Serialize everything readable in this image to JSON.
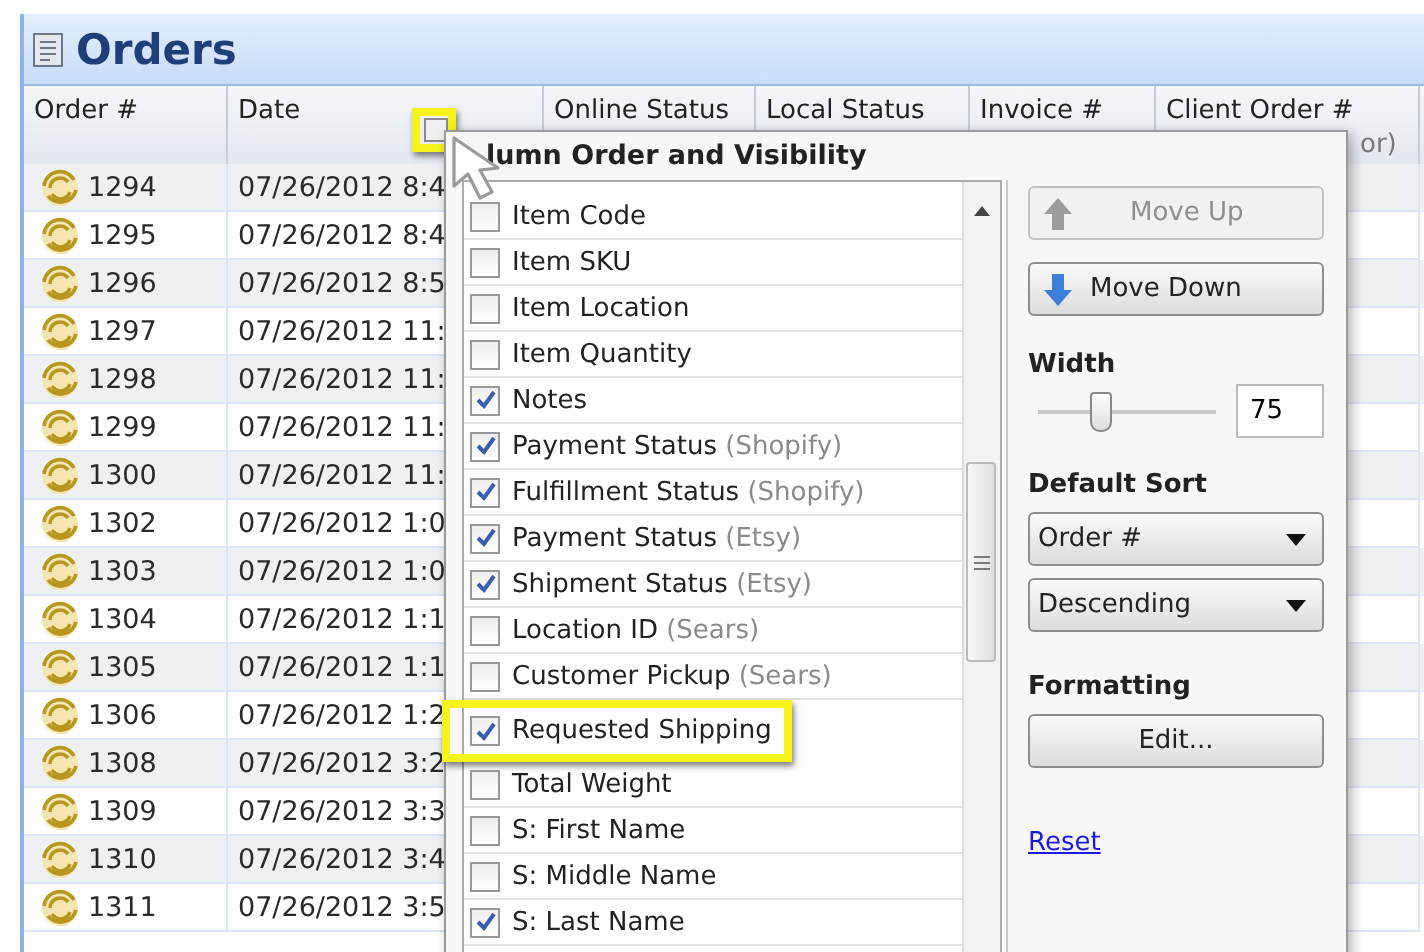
{
  "title": "Orders",
  "columns": [
    {
      "label": "Order #"
    },
    {
      "label": "Date"
    },
    {
      "label": "Online Status"
    },
    {
      "label": "Local Status"
    },
    {
      "label": "Invoice #"
    },
    {
      "label": "Client Order #",
      "label_line_2": "or)"
    }
  ],
  "column_chooser": {
    "highlighted": true
  },
  "rows": [
    {
      "order": "1294",
      "date": "07/26/2012 8:4"
    },
    {
      "order": "1295",
      "date": "07/26/2012 8:4"
    },
    {
      "order": "1296",
      "date": "07/26/2012 8:5"
    },
    {
      "order": "1297",
      "date": "07/26/2012 11:"
    },
    {
      "order": "1298",
      "date": "07/26/2012 11:"
    },
    {
      "order": "1299",
      "date": "07/26/2012 11:"
    },
    {
      "order": "1300",
      "date": "07/26/2012 11:"
    },
    {
      "order": "1302",
      "date": "07/26/2012 1:0"
    },
    {
      "order": "1303",
      "date": "07/26/2012 1:0"
    },
    {
      "order": "1304",
      "date": "07/26/2012 1:1"
    },
    {
      "order": "1305",
      "date": "07/26/2012 1:1"
    },
    {
      "order": "1306",
      "date": "07/26/2012 1:2"
    },
    {
      "order": "1308",
      "date": "07/26/2012 3:2"
    },
    {
      "order": "1309",
      "date": "07/26/2012 3:3"
    },
    {
      "order": "1310",
      "date": "07/26/2012 3:4"
    },
    {
      "order": "1311",
      "date": "07/26/2012 3:5"
    }
  ],
  "popup": {
    "title": "lumn Order and Visibility",
    "items": [
      {
        "label": "Item Code",
        "checked": false,
        "highlighted": false
      },
      {
        "label": "Item SKU",
        "checked": false,
        "highlighted": false
      },
      {
        "label": "Item Location",
        "checked": false,
        "highlighted": false
      },
      {
        "label": "Item Quantity",
        "checked": false,
        "highlighted": false
      },
      {
        "label": "Notes",
        "checked": true,
        "highlighted": false
      },
      {
        "label": "Payment Status",
        "source": "(Shopify)",
        "checked": true,
        "highlighted": false
      },
      {
        "label": "Fulfillment Status",
        "source": "(Shopify)",
        "checked": true,
        "highlighted": false
      },
      {
        "label": "Payment Status",
        "source": "(Etsy)",
        "checked": true,
        "highlighted": false
      },
      {
        "label": "Shipment Status",
        "source": "(Etsy)",
        "checked": true,
        "highlighted": false
      },
      {
        "label": "Location ID",
        "source": "(Sears)",
        "checked": false,
        "highlighted": false
      },
      {
        "label": "Customer Pickup",
        "source": "(Sears)",
        "checked": false,
        "highlighted": false
      },
      {
        "label": "Requested Shipping",
        "checked": true,
        "highlighted": true
      },
      {
        "label": "Total Weight",
        "checked": false,
        "highlighted": false
      },
      {
        "label": "S: First Name",
        "checked": false,
        "highlighted": false
      },
      {
        "label": "S: Middle Name",
        "checked": false,
        "highlighted": false
      },
      {
        "label": "S: Last Name",
        "checked": true,
        "highlighted": false
      }
    ],
    "move_up": {
      "label": "Move Up",
      "disabled": true
    },
    "move_down": {
      "label": "Move Down"
    },
    "width": {
      "label": "Width",
      "level": 0.35,
      "value": "75"
    },
    "default_sort": {
      "label": "Default Sort",
      "field": "Order #",
      "direction": "Descending"
    },
    "formatting": {
      "label": "Formatting",
      "button": "Edit..."
    },
    "reset": "Reset"
  }
}
